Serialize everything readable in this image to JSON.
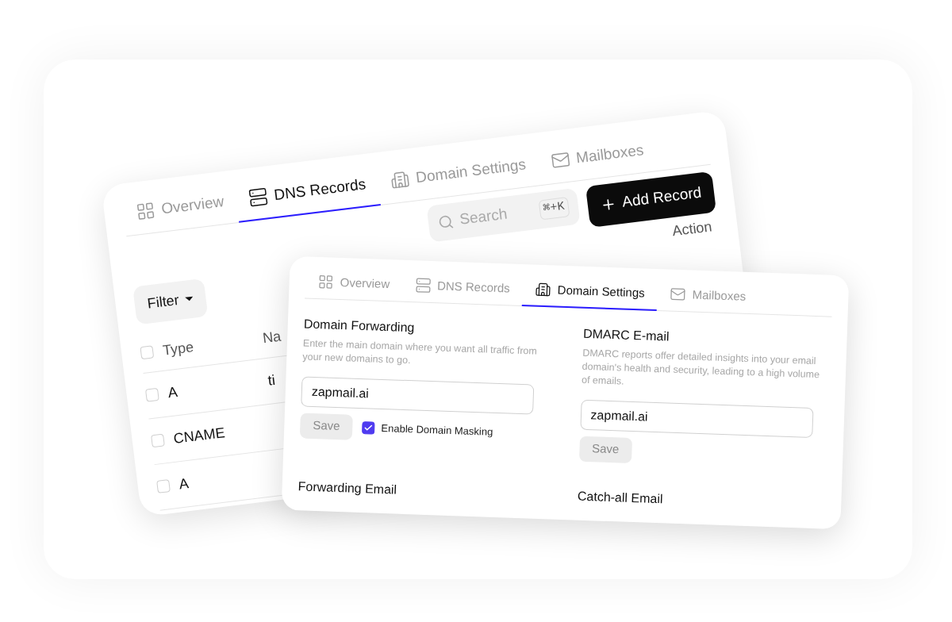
{
  "back_card": {
    "tabs": [
      {
        "label": "Overview",
        "selected": false
      },
      {
        "label": "DNS Records",
        "selected": true
      },
      {
        "label": "Domain Settings",
        "selected": false
      },
      {
        "label": "Mailboxes",
        "selected": false
      }
    ],
    "search": {
      "placeholder": "Search",
      "shortcut": "⌘+K"
    },
    "add_button": {
      "label": "Add Record"
    },
    "filter_button": {
      "label": "Filter"
    },
    "table": {
      "header_checked": false,
      "columns": [
        "Type",
        "Na"
      ],
      "action_column": "Action",
      "rows": [
        {
          "type": "A",
          "name": "ti",
          "checked": false
        },
        {
          "type": "CNAME",
          "checked": false
        },
        {
          "type": "A",
          "checked": false
        }
      ]
    }
  },
  "front_card": {
    "tabs": [
      {
        "label": "Overview",
        "selected": false
      },
      {
        "label": "DNS Records",
        "selected": false
      },
      {
        "label": "Domain Settings",
        "selected": true
      },
      {
        "label": "Mailboxes",
        "selected": false
      }
    ],
    "sections": [
      {
        "title": "Domain Forwarding",
        "description": "Enter the main domain where you want all traffic from your new domains to go.",
        "value": "zapmail.ai",
        "save": {
          "label": "Save",
          "disabled": true
        },
        "checkbox": {
          "label": "Enable Domain Masking",
          "checked": true
        }
      },
      {
        "title": "DMARC E-mail",
        "description": "DMARC reports offer detailed insights into your email domain's health and security, leading to a high volume of emails.",
        "value": "zapmail.ai",
        "save": {
          "label": "Save",
          "disabled": true
        }
      },
      {
        "title": "Forwarding Email"
      },
      {
        "title": "Catch-all Email"
      }
    ]
  }
}
